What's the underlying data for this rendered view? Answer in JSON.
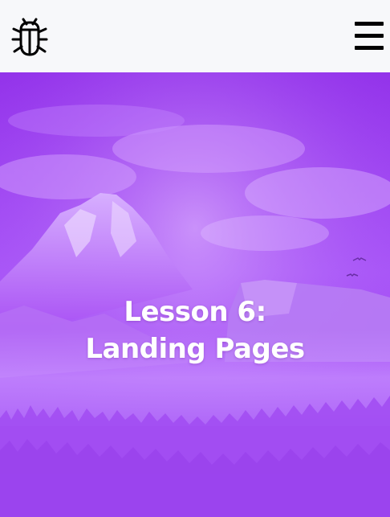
{
  "header": {
    "logo_icon": "bug-icon",
    "menu_icon": "hamburger-menu-icon"
  },
  "hero": {
    "title_line1": "Lesson 6:",
    "title_line2": "Landing Pages",
    "overlay_color": "#9333ea"
  }
}
